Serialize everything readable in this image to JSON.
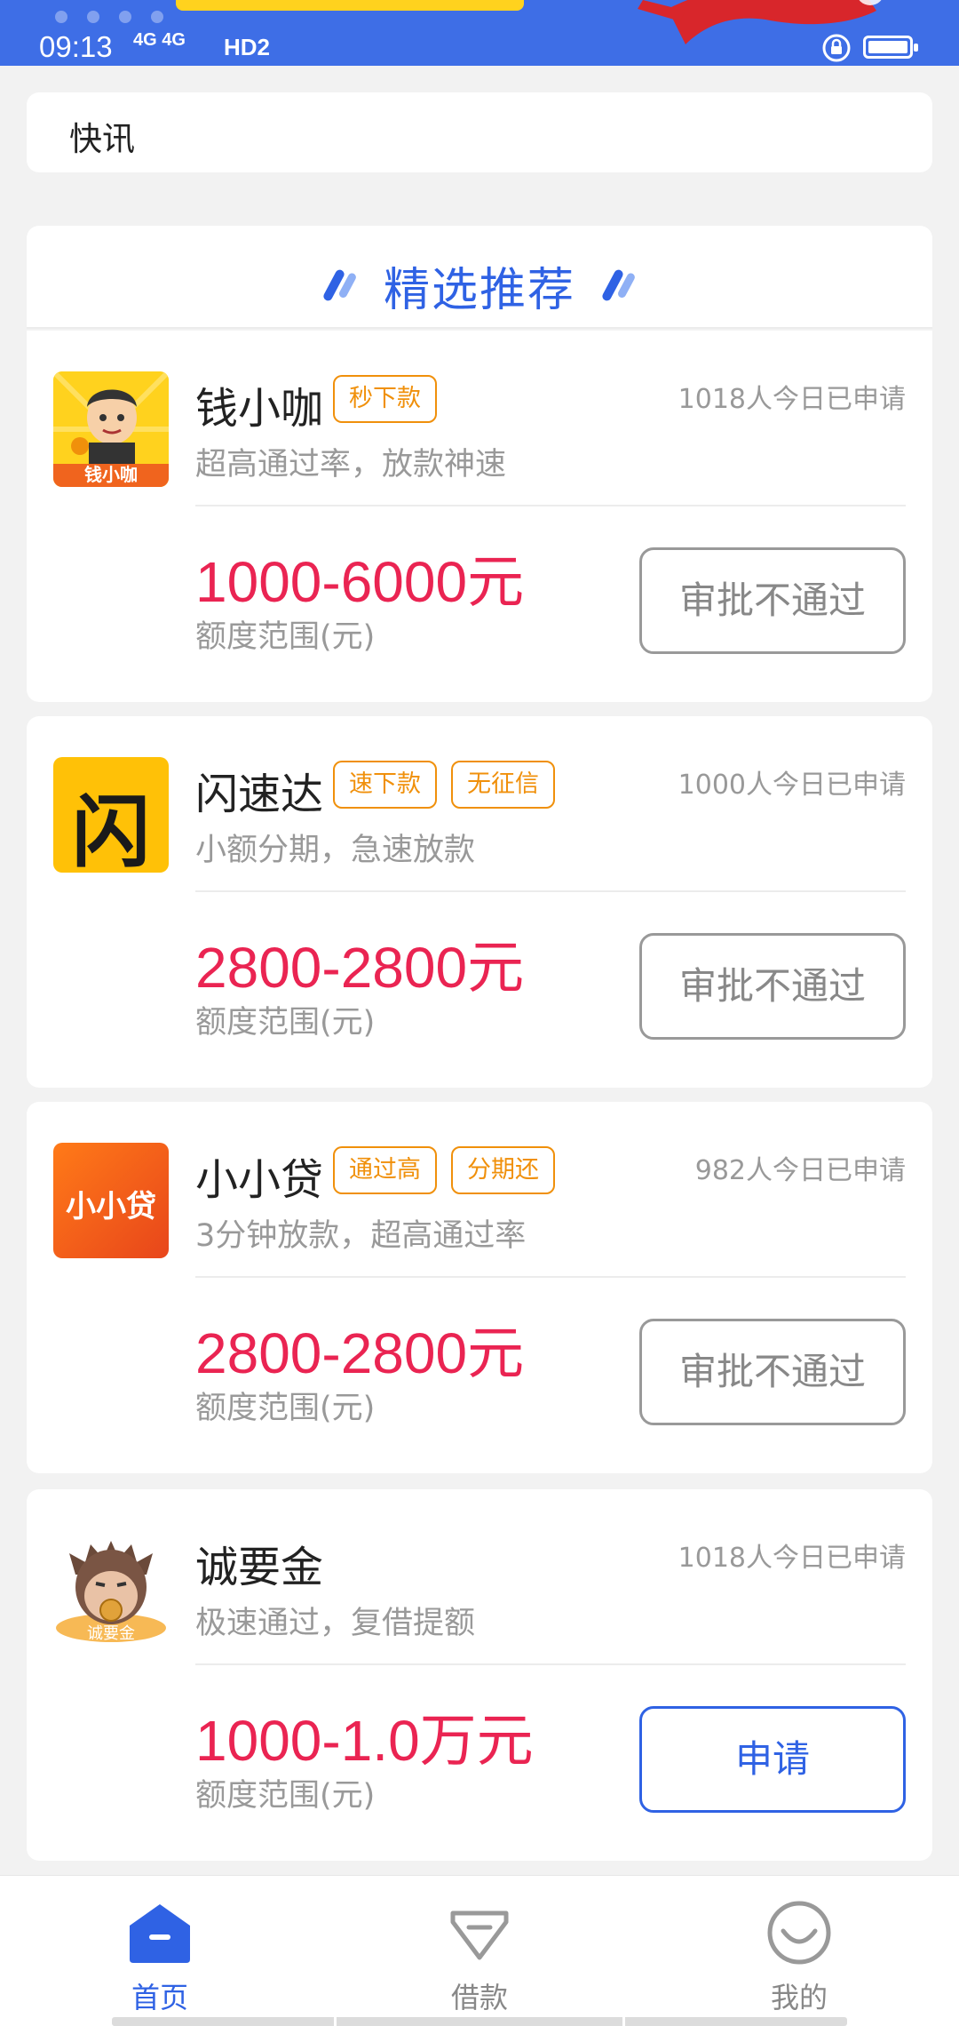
{
  "status_bar": {
    "time": "09:13",
    "signal_label": "4G 4G",
    "network_label": "HD2"
  },
  "news": {
    "label": "快讯"
  },
  "recommend": {
    "title": "精选推荐"
  },
  "products": [
    {
      "name": "钱小咖",
      "logo_text": "钱小咖",
      "tags": [
        "秒下款"
      ],
      "applied": "1018人今日已申请",
      "desc": "超高通过率，放款神速",
      "amount": "1000-6000元",
      "amount_label": "额度范围(元)",
      "button": "审批不通过"
    },
    {
      "name": "闪速达",
      "logo_text": "闪",
      "tags": [
        "速下款",
        "无征信"
      ],
      "applied": "1000人今日已申请",
      "desc": "小额分期，急速放款",
      "amount": "2800-2800元",
      "amount_label": "额度范围(元)",
      "button": "审批不通过"
    },
    {
      "name": "小小贷",
      "logo_text": "小小贷",
      "tags": [
        "通过高",
        "分期还"
      ],
      "applied": "982人今日已申请",
      "desc": "3分钟放款，超高通过率",
      "amount": "2800-2800元",
      "amount_label": "额度范围(元)",
      "button": "审批不通过"
    },
    {
      "name": "诚要金",
      "logo_text": "诚要金",
      "tags": [],
      "applied": "1018人今日已申请",
      "desc": "极速通过，复借提额",
      "amount": "1000-1.0万元",
      "amount_label": "额度范围(元)",
      "button": "申请"
    }
  ],
  "nav": [
    {
      "label": "首页",
      "icon": "home-icon",
      "active": true
    },
    {
      "label": "借款",
      "icon": "loan-icon",
      "active": false
    },
    {
      "label": "我的",
      "icon": "profile-icon",
      "active": false
    }
  ],
  "colors": {
    "brand_blue": "#2f62e4",
    "status_bar": "#3e6ee6",
    "amount_red": "#ea2452",
    "tag_orange": "#f0900b"
  }
}
